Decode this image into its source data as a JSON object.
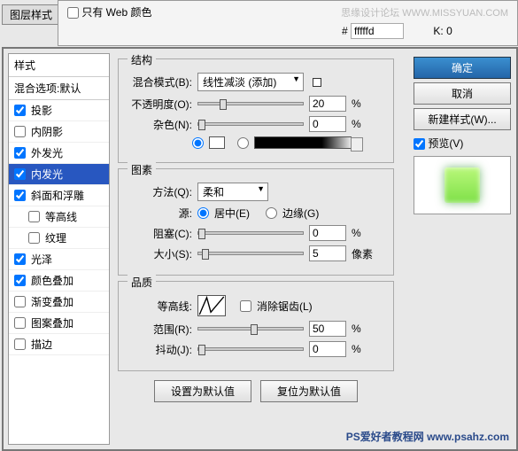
{
  "tab_title": "图层样式",
  "top": {
    "web_only": "只有 Web 颜色",
    "hash": "#",
    "hex": "fffffd",
    "k_label": "K:",
    "k_value": "0",
    "watermark": "思缘设计论坛  WWW.MISSYUAN.COM"
  },
  "left": {
    "header": "样式",
    "sub": "混合选项:默认",
    "items": [
      {
        "label": "投影",
        "checked": true
      },
      {
        "label": "内阴影",
        "checked": false
      },
      {
        "label": "外发光",
        "checked": true
      },
      {
        "label": "内发光",
        "checked": true,
        "selected": true
      },
      {
        "label": "斜面和浮雕",
        "checked": true
      },
      {
        "label": "等高线",
        "checked": false,
        "sub": true
      },
      {
        "label": "纹理",
        "checked": false,
        "sub": true
      },
      {
        "label": "光泽",
        "checked": true
      },
      {
        "label": "颜色叠加",
        "checked": true
      },
      {
        "label": "渐变叠加",
        "checked": false
      },
      {
        "label": "图案叠加",
        "checked": false
      },
      {
        "label": "描边",
        "checked": false
      }
    ]
  },
  "struct": {
    "title": "结构",
    "blend_label": "混合模式(B):",
    "blend_value": "线性减淡 (添加)",
    "opacity_label": "不透明度(O):",
    "opacity_value": "20",
    "pct": "%",
    "noise_label": "杂色(N):",
    "noise_value": "0"
  },
  "element": {
    "title": "图素",
    "method_label": "方法(Q):",
    "method_value": "柔和",
    "source_label": "源:",
    "center": "居中(E)",
    "edge": "边缘(G)",
    "choke_label": "阻塞(C):",
    "choke_value": "0",
    "pct": "%",
    "size_label": "大小(S):",
    "size_value": "5",
    "px": "像素"
  },
  "quality": {
    "title": "品质",
    "contour_label": "等高线:",
    "antialias": "消除锯齿(L)",
    "range_label": "范围(R):",
    "range_value": "50",
    "pct": "%",
    "jitter_label": "抖动(J):",
    "jitter_value": "0"
  },
  "bottom": {
    "set_default": "设置为默认值",
    "reset_default": "复位为默认值"
  },
  "right": {
    "ok": "确定",
    "cancel": "取消",
    "new_style": "新建样式(W)...",
    "preview": "预览(V)"
  },
  "watermark_bottom": "PS爱好者教程网  www.psahz.com"
}
